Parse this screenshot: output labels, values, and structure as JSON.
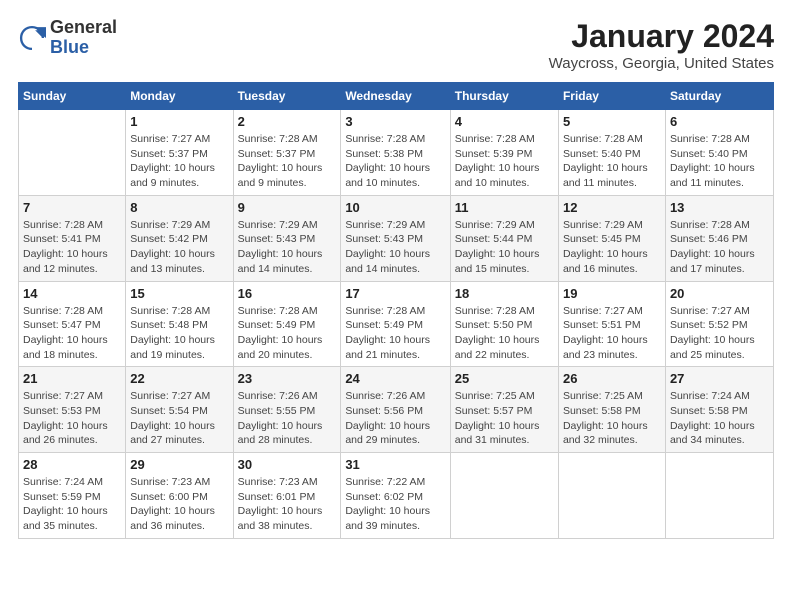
{
  "logo": {
    "general": "General",
    "blue": "Blue"
  },
  "title": "January 2024",
  "subtitle": "Waycross, Georgia, United States",
  "days_header": [
    "Sunday",
    "Monday",
    "Tuesday",
    "Wednesday",
    "Thursday",
    "Friday",
    "Saturday"
  ],
  "weeks": [
    [
      {
        "num": "",
        "info": ""
      },
      {
        "num": "1",
        "info": "Sunrise: 7:27 AM\nSunset: 5:37 PM\nDaylight: 10 hours\nand 9 minutes."
      },
      {
        "num": "2",
        "info": "Sunrise: 7:28 AM\nSunset: 5:37 PM\nDaylight: 10 hours\nand 9 minutes."
      },
      {
        "num": "3",
        "info": "Sunrise: 7:28 AM\nSunset: 5:38 PM\nDaylight: 10 hours\nand 10 minutes."
      },
      {
        "num": "4",
        "info": "Sunrise: 7:28 AM\nSunset: 5:39 PM\nDaylight: 10 hours\nand 10 minutes."
      },
      {
        "num": "5",
        "info": "Sunrise: 7:28 AM\nSunset: 5:40 PM\nDaylight: 10 hours\nand 11 minutes."
      },
      {
        "num": "6",
        "info": "Sunrise: 7:28 AM\nSunset: 5:40 PM\nDaylight: 10 hours\nand 11 minutes."
      }
    ],
    [
      {
        "num": "7",
        "info": "Sunrise: 7:28 AM\nSunset: 5:41 PM\nDaylight: 10 hours\nand 12 minutes."
      },
      {
        "num": "8",
        "info": "Sunrise: 7:29 AM\nSunset: 5:42 PM\nDaylight: 10 hours\nand 13 minutes."
      },
      {
        "num": "9",
        "info": "Sunrise: 7:29 AM\nSunset: 5:43 PM\nDaylight: 10 hours\nand 14 minutes."
      },
      {
        "num": "10",
        "info": "Sunrise: 7:29 AM\nSunset: 5:43 PM\nDaylight: 10 hours\nand 14 minutes."
      },
      {
        "num": "11",
        "info": "Sunrise: 7:29 AM\nSunset: 5:44 PM\nDaylight: 10 hours\nand 15 minutes."
      },
      {
        "num": "12",
        "info": "Sunrise: 7:29 AM\nSunset: 5:45 PM\nDaylight: 10 hours\nand 16 minutes."
      },
      {
        "num": "13",
        "info": "Sunrise: 7:28 AM\nSunset: 5:46 PM\nDaylight: 10 hours\nand 17 minutes."
      }
    ],
    [
      {
        "num": "14",
        "info": "Sunrise: 7:28 AM\nSunset: 5:47 PM\nDaylight: 10 hours\nand 18 minutes."
      },
      {
        "num": "15",
        "info": "Sunrise: 7:28 AM\nSunset: 5:48 PM\nDaylight: 10 hours\nand 19 minutes."
      },
      {
        "num": "16",
        "info": "Sunrise: 7:28 AM\nSunset: 5:49 PM\nDaylight: 10 hours\nand 20 minutes."
      },
      {
        "num": "17",
        "info": "Sunrise: 7:28 AM\nSunset: 5:49 PM\nDaylight: 10 hours\nand 21 minutes."
      },
      {
        "num": "18",
        "info": "Sunrise: 7:28 AM\nSunset: 5:50 PM\nDaylight: 10 hours\nand 22 minutes."
      },
      {
        "num": "19",
        "info": "Sunrise: 7:27 AM\nSunset: 5:51 PM\nDaylight: 10 hours\nand 23 minutes."
      },
      {
        "num": "20",
        "info": "Sunrise: 7:27 AM\nSunset: 5:52 PM\nDaylight: 10 hours\nand 25 minutes."
      }
    ],
    [
      {
        "num": "21",
        "info": "Sunrise: 7:27 AM\nSunset: 5:53 PM\nDaylight: 10 hours\nand 26 minutes."
      },
      {
        "num": "22",
        "info": "Sunrise: 7:27 AM\nSunset: 5:54 PM\nDaylight: 10 hours\nand 27 minutes."
      },
      {
        "num": "23",
        "info": "Sunrise: 7:26 AM\nSunset: 5:55 PM\nDaylight: 10 hours\nand 28 minutes."
      },
      {
        "num": "24",
        "info": "Sunrise: 7:26 AM\nSunset: 5:56 PM\nDaylight: 10 hours\nand 29 minutes."
      },
      {
        "num": "25",
        "info": "Sunrise: 7:25 AM\nSunset: 5:57 PM\nDaylight: 10 hours\nand 31 minutes."
      },
      {
        "num": "26",
        "info": "Sunrise: 7:25 AM\nSunset: 5:58 PM\nDaylight: 10 hours\nand 32 minutes."
      },
      {
        "num": "27",
        "info": "Sunrise: 7:24 AM\nSunset: 5:58 PM\nDaylight: 10 hours\nand 34 minutes."
      }
    ],
    [
      {
        "num": "28",
        "info": "Sunrise: 7:24 AM\nSunset: 5:59 PM\nDaylight: 10 hours\nand 35 minutes."
      },
      {
        "num": "29",
        "info": "Sunrise: 7:23 AM\nSunset: 6:00 PM\nDaylight: 10 hours\nand 36 minutes."
      },
      {
        "num": "30",
        "info": "Sunrise: 7:23 AM\nSunset: 6:01 PM\nDaylight: 10 hours\nand 38 minutes."
      },
      {
        "num": "31",
        "info": "Sunrise: 7:22 AM\nSunset: 6:02 PM\nDaylight: 10 hours\nand 39 minutes."
      },
      {
        "num": "",
        "info": ""
      },
      {
        "num": "",
        "info": ""
      },
      {
        "num": "",
        "info": ""
      }
    ]
  ]
}
